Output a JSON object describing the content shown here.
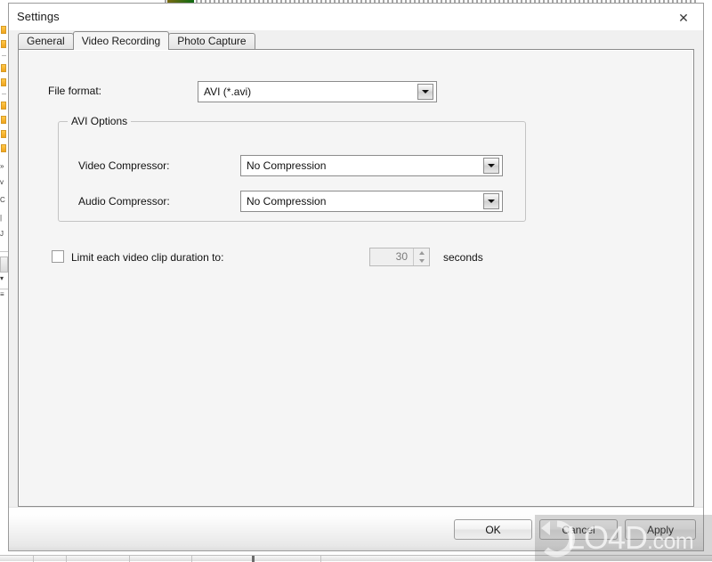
{
  "window": {
    "title": "Settings",
    "close_icon": "close-icon",
    "close_label": "✕"
  },
  "tabs": [
    {
      "label": "General",
      "selected": false
    },
    {
      "label": "Video Recording",
      "selected": true
    },
    {
      "label": "Photo Capture",
      "selected": false
    }
  ],
  "video_recording": {
    "file_format": {
      "label": "File format:",
      "value": "AVI (*.avi)",
      "arrow_icon": "chevron-down-icon"
    },
    "avi_options": {
      "title": "AVI Options",
      "video_compressor": {
        "label": "Video Compressor:",
        "value": "No Compression",
        "arrow_icon": "chevron-down-icon"
      },
      "audio_compressor": {
        "label": "Audio Compressor:",
        "value": "No Compression",
        "arrow_icon": "chevron-down-icon"
      }
    },
    "limit_clip": {
      "label": "Limit each video clip duration to:",
      "checked": false,
      "duration_value": "30",
      "units_label": "seconds",
      "up_icon": "spinner-up-icon",
      "down_icon": "spinner-down-icon"
    }
  },
  "footer": {
    "ok_label": "OK",
    "cancel_label": "Cancel",
    "apply_label": "Apply"
  },
  "watermark": {
    "text": "LO4D",
    "suffix": ".com",
    "logo_icon": "refresh-circle-logo-icon"
  },
  "colors": {
    "dialog_face": "#f0f0f0",
    "panel_face": "#f5f5f5",
    "border": "#8b8b8b",
    "text": "#111111",
    "disabled_text": "#7a7a7a",
    "accent_orange": "#f0a31c"
  }
}
